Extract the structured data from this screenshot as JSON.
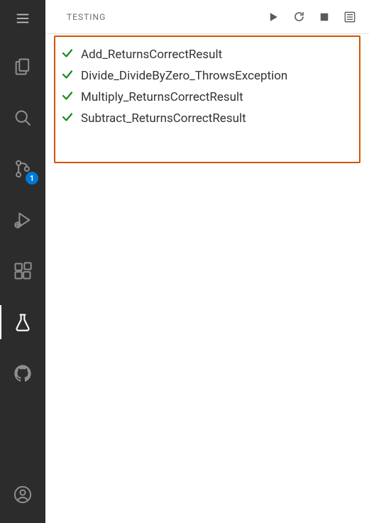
{
  "panel": {
    "title": "TESTING"
  },
  "source_control": {
    "badge": "1"
  },
  "tests": [
    {
      "name": "Add_ReturnsCorrectResult",
      "status": "pass"
    },
    {
      "name": "Divide_DivideByZero_ThrowsException",
      "status": "pass"
    },
    {
      "name": "Multiply_ReturnsCorrectResult",
      "status": "pass"
    },
    {
      "name": "Subtract_ReturnsCorrectResult",
      "status": "pass"
    }
  ],
  "colors": {
    "pass": "#1b8a1b",
    "highlight": "#d35400",
    "badge": "#0078d4"
  }
}
